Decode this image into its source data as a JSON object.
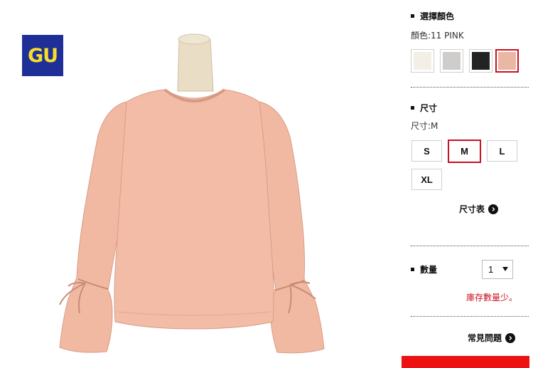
{
  "brand": {
    "logo_text": "GU",
    "logo_bg": "#1e2f97",
    "logo_fg": "#f6dd2a"
  },
  "product": {
    "garment_color": "#f2b9a2"
  },
  "color_section": {
    "title": "選擇顏色",
    "selected_label": "顏色:11 PINK",
    "swatches": [
      {
        "name": "off-white",
        "hex": "#f3efe6",
        "selected": false
      },
      {
        "name": "gray",
        "hex": "#cfcdcc",
        "selected": false
      },
      {
        "name": "black",
        "hex": "#232323",
        "selected": false
      },
      {
        "name": "pink",
        "hex": "#e9b7a3",
        "selected": true
      }
    ]
  },
  "size_section": {
    "title": "尺寸",
    "selected_label": "尺寸:M",
    "sizes": [
      {
        "label": "S",
        "selected": false
      },
      {
        "label": "M",
        "selected": true
      },
      {
        "label": "L",
        "selected": false
      },
      {
        "label": "XL",
        "selected": false
      }
    ],
    "size_chart_link": "尺寸表"
  },
  "quantity_section": {
    "title": "數量",
    "value": "1",
    "stock_warning": "庫存數量少。"
  },
  "faq_link": "常見問題",
  "accent_color": "#c8111f"
}
